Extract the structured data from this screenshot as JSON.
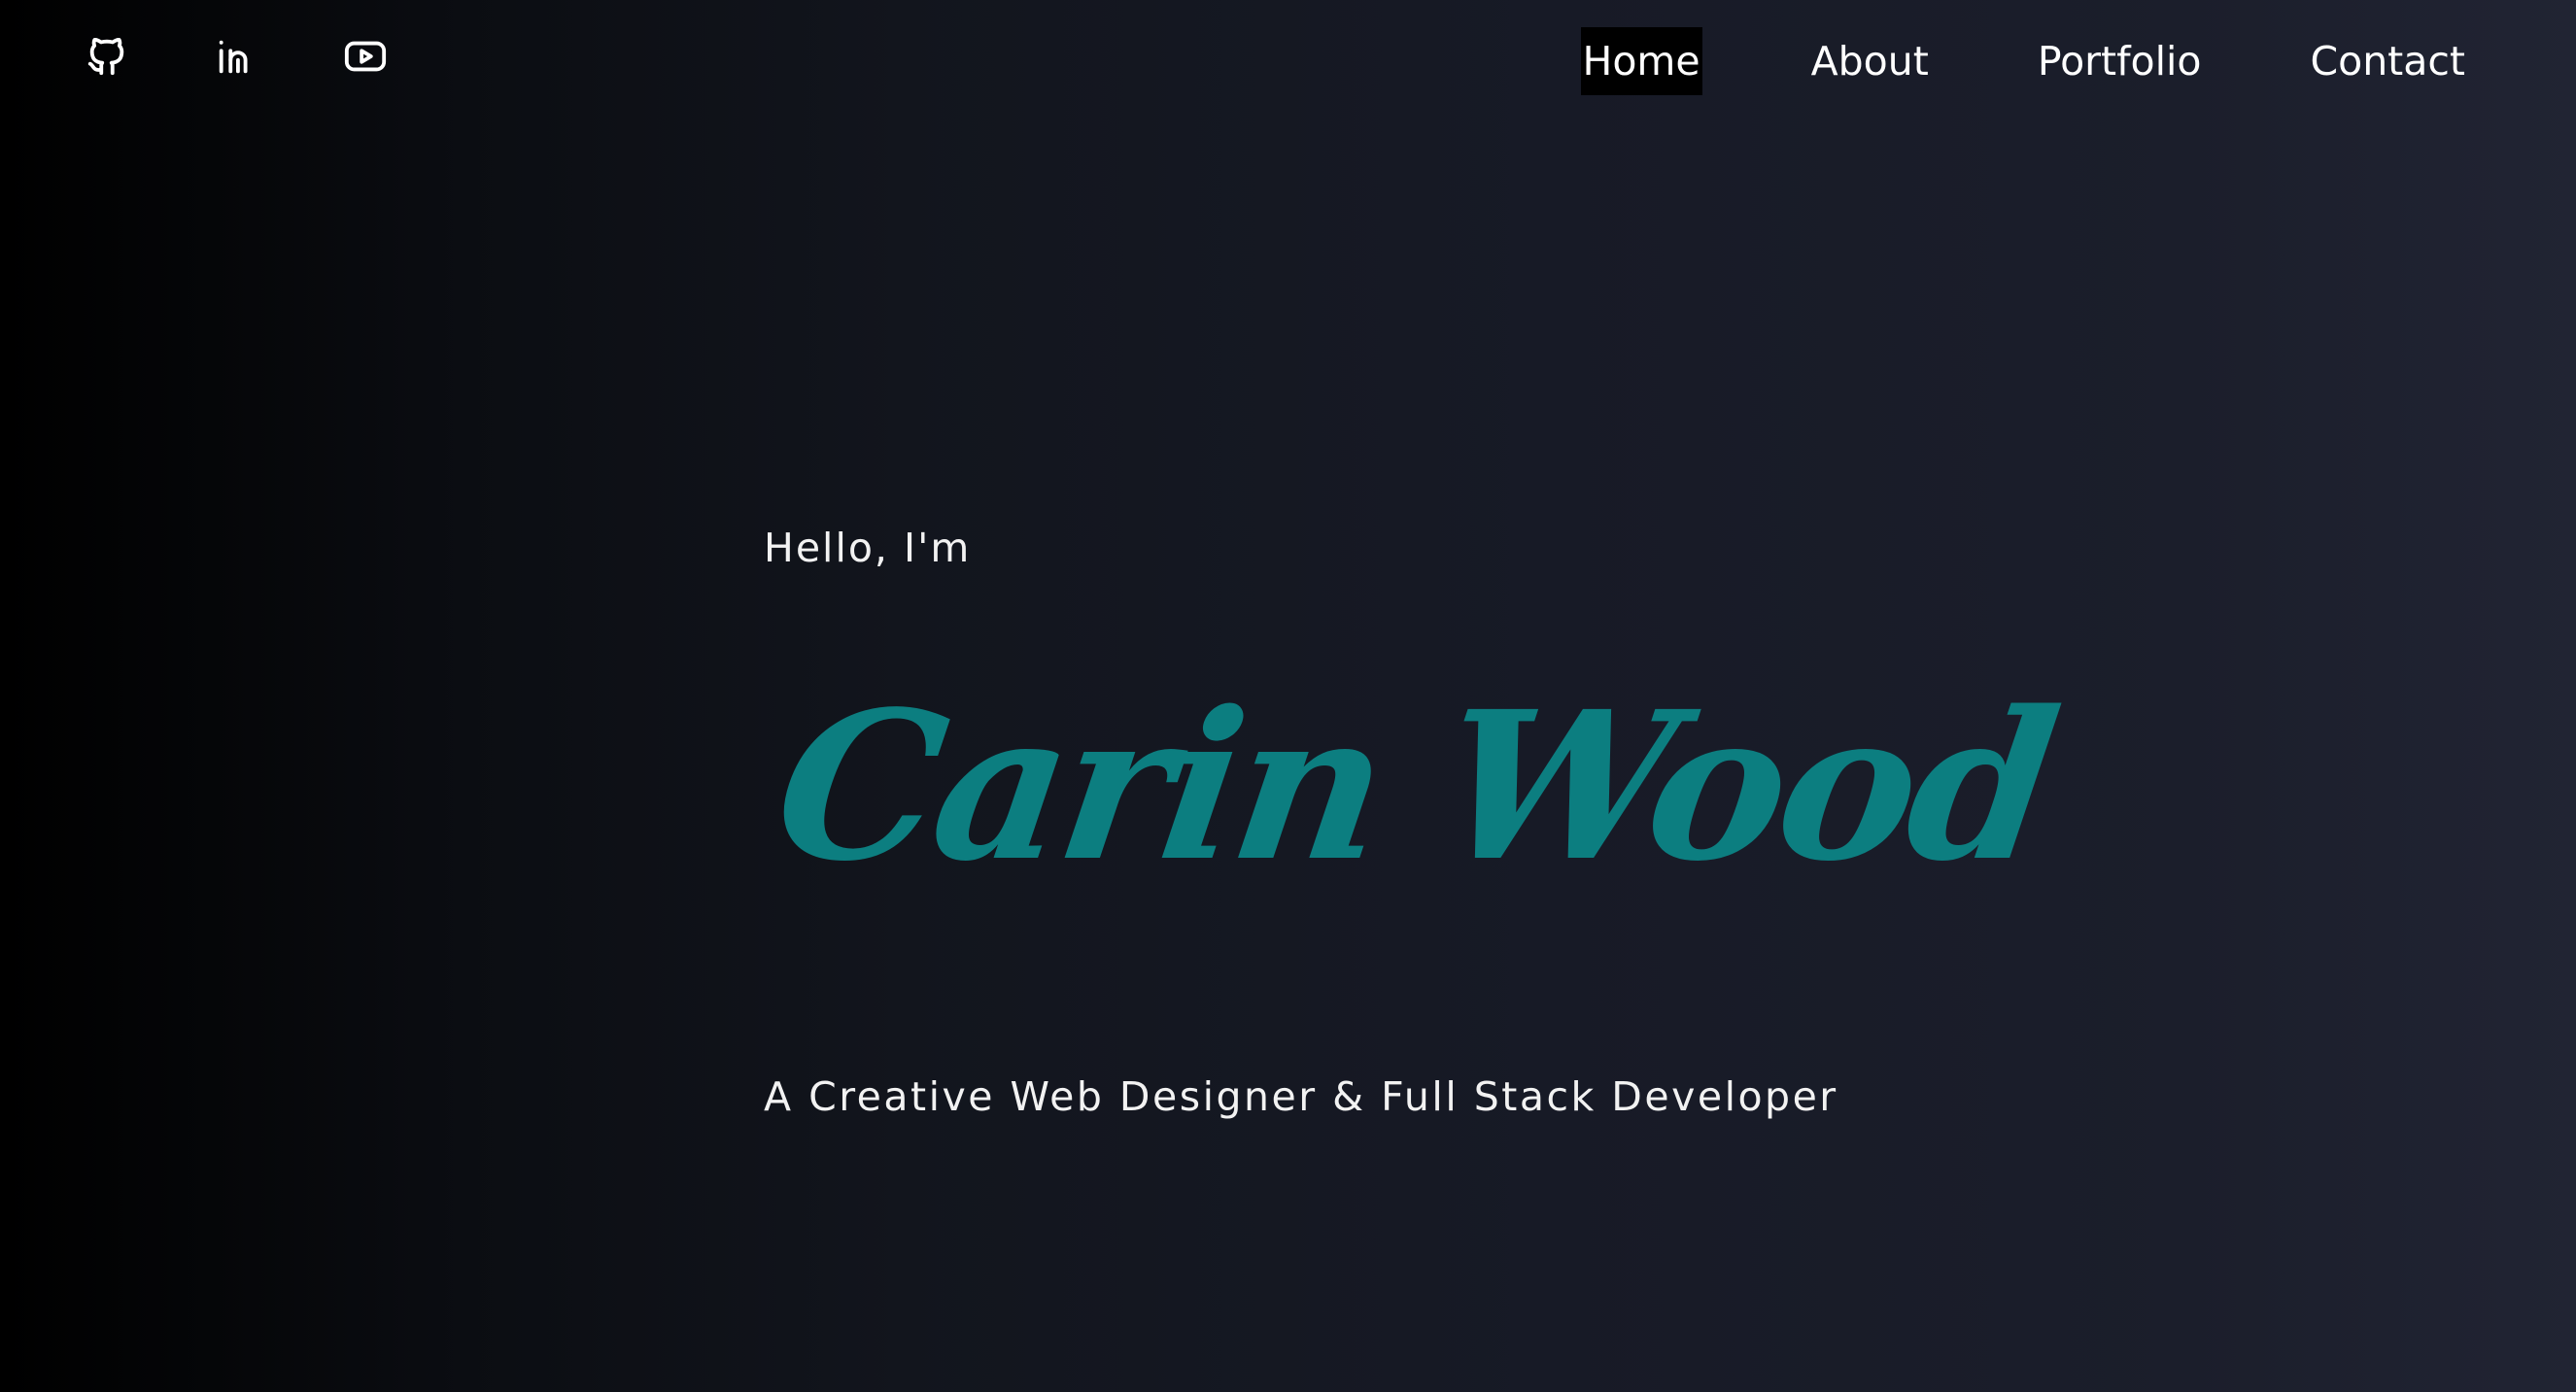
{
  "social": {
    "items": [
      {
        "icon": "github-icon",
        "label": "GitHub"
      },
      {
        "icon": "linkedin-icon",
        "label": "LinkedIn"
      },
      {
        "icon": "youtube-icon",
        "label": "YouTube"
      }
    ]
  },
  "nav": {
    "items": [
      {
        "label": "Home",
        "active": true
      },
      {
        "label": "About",
        "active": false
      },
      {
        "label": "Portfolio",
        "active": false
      },
      {
        "label": "Contact",
        "active": false
      }
    ]
  },
  "hero": {
    "greeting": "Hello, I'm",
    "name": "Carin Wood",
    "tagline": "A Creative Web Designer & Full Stack Developer"
  },
  "colors": {
    "accent": "#0c7e80",
    "text": "#ffffff",
    "background_dark": "#000000",
    "background_light": "#212433",
    "active_nav_bg": "#000000"
  }
}
